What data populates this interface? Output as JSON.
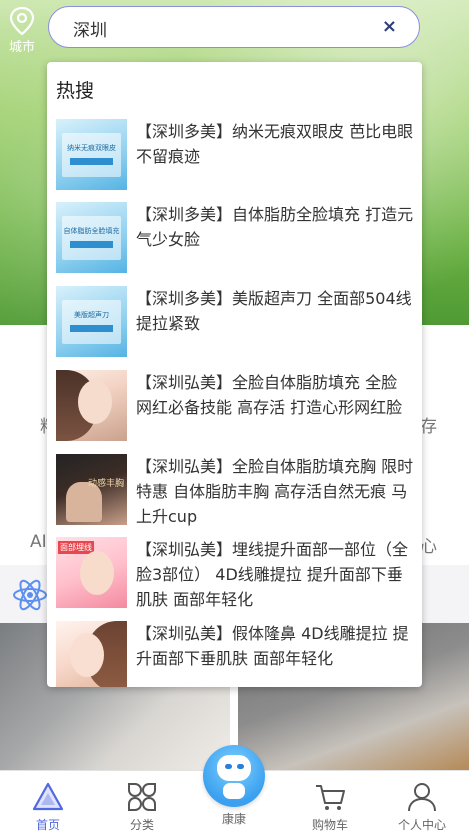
{
  "header": {
    "city_label": "城市",
    "search_value": "深圳",
    "clear_icon": "×"
  },
  "dropdown": {
    "title": "热搜",
    "items": [
      {
        "text": "【深圳多美】纳米无痕双眼皮 芭比电眼不留痕迹",
        "thumb": "blue",
        "thumb_text": "纳米无痕双眼皮"
      },
      {
        "text": "【深圳多美】自体脂肪全脸填充 打造元气少女脸",
        "thumb": "blue",
        "thumb_text": "自体脂肪全脸填充"
      },
      {
        "text": "【深圳多美】美版超声刀 全面部504线 提拉紧致",
        "thumb": "blue",
        "thumb_text": "美版超声刀"
      },
      {
        "text": "【深圳弘美】全脸自体脂肪填充 全脸 网红必备技能 高存活 打造心形网红脸",
        "thumb": "face"
      },
      {
        "text": "【深圳弘美】全脸自体脂肪填充胸 限时特惠 自体脂肪丰胸 高存活自然无痕 马上升cup",
        "thumb": "dark",
        "thumb_text": "动感丰胸"
      },
      {
        "text": "【深圳弘美】埋线提升面部一部位（全脸3部位） 4D线雕提拉 提升面部下垂肌肤 面部年轻化",
        "thumb": "pink",
        "thumb_text": "面部埋线"
      },
      {
        "text": "【深圳弘美】假体隆鼻 4D线雕提拉 提升面部下垂肌肤 面部年轻化",
        "thumb": "face2"
      }
    ]
  },
  "background": {
    "ghost_left_1": "料",
    "ghost_right_1": "存",
    "ghost_left_2": "AI",
    "ghost_right_2": "心"
  },
  "tabbar": {
    "tabs": [
      {
        "label": "首页",
        "icon": "home-triangle-icon"
      },
      {
        "label": "分类",
        "icon": "category-icon"
      },
      {
        "label": "康康",
        "icon": "robot-icon"
      },
      {
        "label": "购物车",
        "icon": "cart-icon"
      },
      {
        "label": "个人中心",
        "icon": "user-icon"
      }
    ],
    "active_color": "#5168e0"
  }
}
